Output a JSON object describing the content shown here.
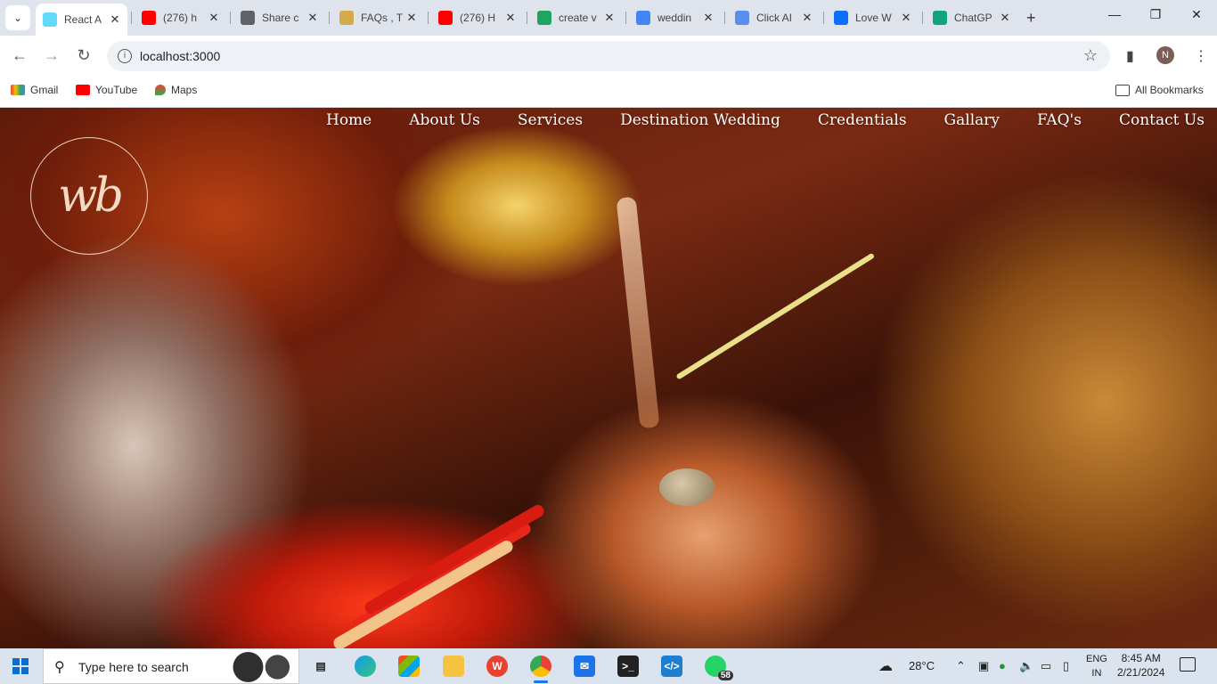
{
  "browser": {
    "tabs": [
      {
        "title": "React A",
        "icon": "react-icon",
        "color": "#61dafb",
        "active": true
      },
      {
        "title": "(276) h",
        "icon": "youtube-icon",
        "color": "#ff0000",
        "active": false
      },
      {
        "title": "Share c",
        "icon": "globe-icon",
        "color": "#5f6368",
        "active": false
      },
      {
        "title": "FAQs , T",
        "icon": "wordpress-icon",
        "color": "#d4a94a",
        "active": false
      },
      {
        "title": "(276) H",
        "icon": "youtube-icon",
        "color": "#ff0000",
        "active": false
      },
      {
        "title": "create v",
        "icon": "google-drive-icon",
        "color": "#1fa463",
        "active": false
      },
      {
        "title": "weddin",
        "icon": "google-icon",
        "color": "#4285f4",
        "active": false
      },
      {
        "title": "Click AI",
        "icon": "cloud-icon",
        "color": "#5b8def",
        "active": false
      },
      {
        "title": "Love W",
        "icon": "bing-icon",
        "color": "#0d6efd",
        "active": false
      },
      {
        "title": "ChatGP",
        "icon": "chatgpt-icon",
        "color": "#10a37f",
        "active": false
      }
    ],
    "url": "localhost:3000",
    "profile_initial": "N",
    "bookmarks": [
      {
        "label": "Gmail",
        "icon": "gmail-icon"
      },
      {
        "label": "YouTube",
        "icon": "youtube-icon"
      },
      {
        "label": "Maps",
        "icon": "maps-icon"
      }
    ],
    "all_bookmarks": "All Bookmarks"
  },
  "site": {
    "logo_text": "wb",
    "nav": [
      "Home",
      "About Us",
      "Services",
      "Destination Wedding",
      "Credentials",
      "Gallary",
      "FAQ's",
      "Contact Us"
    ]
  },
  "taskbar": {
    "search_placeholder": "Type here to search",
    "whatsapp_badge": "58",
    "weather": "28°C",
    "lang_top": "ENG",
    "lang_bottom": "IN",
    "time": "8:45 AM",
    "date": "2/21/2024"
  }
}
